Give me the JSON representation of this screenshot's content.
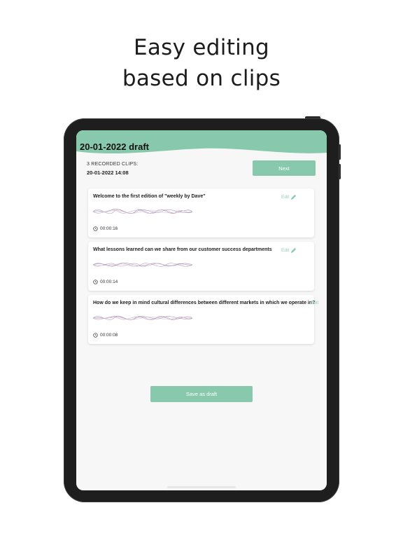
{
  "headline": {
    "line1": "Easy editing",
    "line2": "based on clips"
  },
  "app": {
    "title": "20-01-2022 draft",
    "clips_label": "3 RECORDED CLIPS:",
    "clips_date": "20-01-2022 14:08",
    "next_label": "Next",
    "save_label": "Save as draft",
    "edit_label": "Edit",
    "accent_color": "#88c9ae",
    "icons": [
      "pencil-icon",
      "clock-icon",
      "waveform"
    ]
  },
  "clips": [
    {
      "question": "Welcome to the first edition of \"weekly by Dave\"",
      "duration": "00:00:16"
    },
    {
      "question": "What lessons learned can we share from our customer success departments",
      "duration": "00:00:14"
    },
    {
      "question": "How do we keep in mind cultural differences between different markets in which we operate in?",
      "duration": "00:00:08"
    }
  ]
}
